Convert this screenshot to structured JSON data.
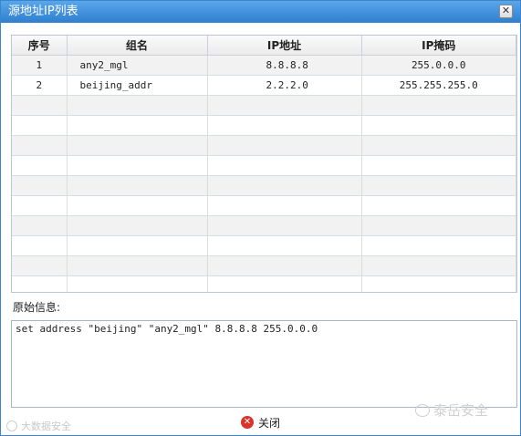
{
  "window": {
    "title": "源地址IP列表",
    "close_glyph": "✕"
  },
  "table": {
    "headers": [
      "序号",
      "组名",
      "IP地址",
      "IP掩码"
    ],
    "rows": [
      [
        "1",
        "any2_mgl",
        "8.8.8.8",
        "255.0.0.0"
      ],
      [
        "2",
        "beijing_addr",
        "2.2.2.0",
        "255.255.255.0"
      ]
    ],
    "empty_row_count": 10
  },
  "raw_info": {
    "label": "原始信息:",
    "text": "set address \"beijing\" \"any2_mgl\" 8.8.8.8 255.0.0.0"
  },
  "footer": {
    "close_label": "关闭",
    "close_icon": "x-circle-icon"
  },
  "watermarks": {
    "left": "大数据安全",
    "right": "泰岳安全"
  },
  "colors": {
    "titlebar": "#3a8ad8",
    "close_icon": "#d9342b"
  }
}
